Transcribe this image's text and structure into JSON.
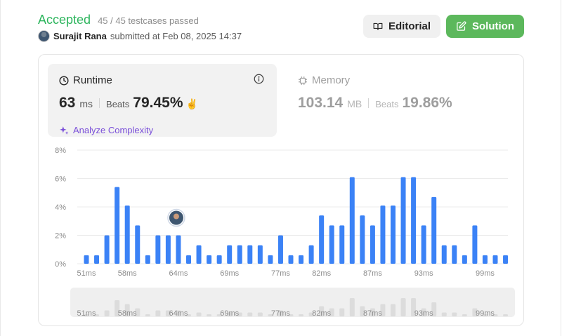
{
  "header": {
    "status": "Accepted",
    "testcases": "45 / 45 testcases passed",
    "user_name": "Surajit Rana",
    "submitted_text": "submitted at Feb 08, 2025 14:37",
    "editorial_label": "Editorial",
    "solution_label": "Solution"
  },
  "runtime": {
    "title": "Runtime",
    "value": "63",
    "unit": "ms",
    "beats_label": "Beats",
    "beats_pct": "79.45%",
    "analyze_label": "Analyze Complexity"
  },
  "memory": {
    "title": "Memory",
    "value": "103.14",
    "unit": "MB",
    "beats_label": "Beats",
    "beats_pct": "19.86%"
  },
  "colors": {
    "accepted": "#2db55d",
    "solution_button": "#5cb85c",
    "bar": "#3b82f6",
    "analyze": "#7a4fd9"
  },
  "chart_data": {
    "type": "bar",
    "ylabel": "",
    "xlabel": "",
    "ylim": [
      0,
      8
    ],
    "y_ticks": [
      "8%",
      "6%",
      "4%",
      "2%",
      "0%"
    ],
    "x_tick_labels": [
      "51ms",
      "58ms",
      "64ms",
      "69ms",
      "77ms",
      "82ms",
      "87ms",
      "93ms",
      "99ms"
    ],
    "x_tick_positions": [
      0,
      4,
      9,
      14,
      19,
      23,
      28,
      33,
      39
    ],
    "values": [
      0.6,
      0.6,
      2.0,
      5.4,
      4.1,
      2.7,
      0.6,
      2.0,
      2.0,
      2.0,
      0.6,
      1.3,
      0.6,
      0.6,
      1.3,
      1.3,
      1.3,
      1.3,
      0.6,
      2.0,
      0.6,
      0.6,
      1.3,
      3.4,
      2.7,
      2.7,
      6.1,
      3.4,
      2.7,
      4.1,
      4.1,
      6.1,
      6.1,
      2.7,
      4.7,
      1.3,
      1.3,
      0.6,
      2.7,
      0.6,
      0.6,
      0.6
    ],
    "user_bar_index": 9,
    "grid": true
  }
}
